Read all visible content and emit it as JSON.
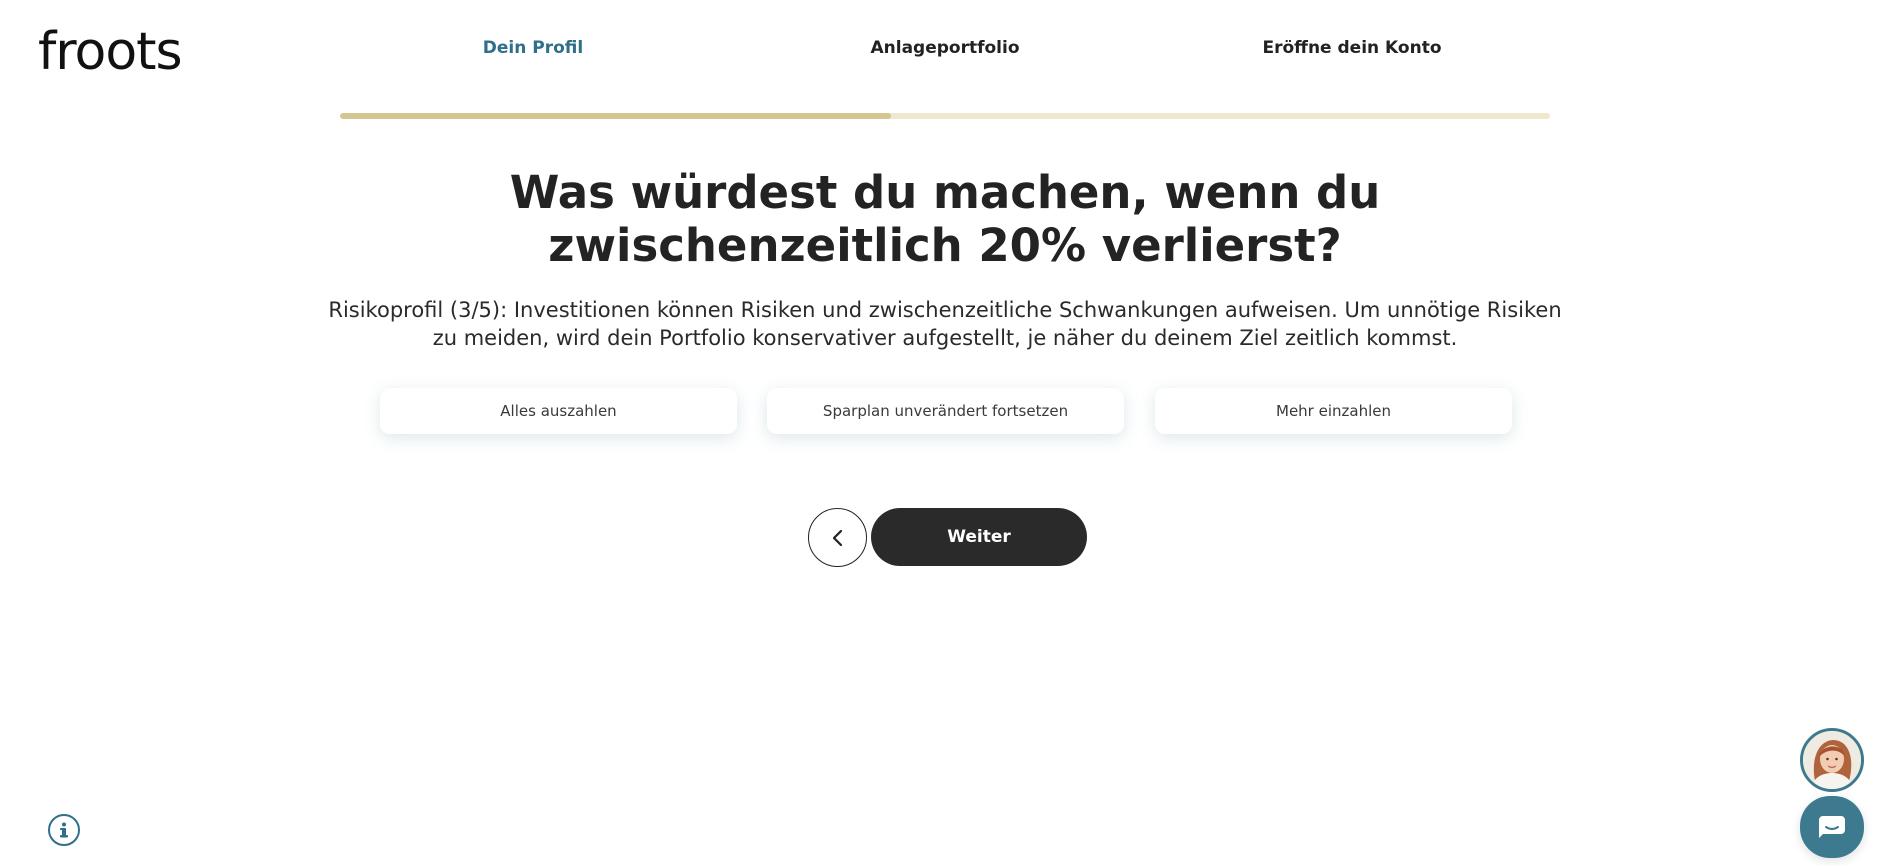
{
  "brand": {
    "logo_text": "froots"
  },
  "steps": [
    {
      "label": "Dein Profil",
      "active": true
    },
    {
      "label": "Anlageportfolio",
      "active": false
    },
    {
      "label": "Eröffne dein Konto",
      "active": false
    }
  ],
  "progress": {
    "fraction": 0.455
  },
  "question": {
    "title": "Was würdest du machen, wenn du zwischenzeitlich 20% verlierst?",
    "description": "Risikoprofil (3/5): Investitionen können Risiken und zwischenzeitliche Schwankungen aufweisen. Um unnötige Risiken zu meiden, wird dein Portfolio konservativer aufgestellt, je näher du deinem Ziel zeitlich kommst."
  },
  "options": [
    {
      "label": "Alles auszahlen"
    },
    {
      "label": "Sparplan unverändert fortsetzen"
    },
    {
      "label": "Mehr einzahlen"
    }
  ],
  "navigation": {
    "back_icon": "chevron-left-icon",
    "next_label": "Weiter"
  },
  "widgets": {
    "info_icon": "info-icon",
    "chat_icon": "chat-icon",
    "avatar": "advisor-avatar"
  },
  "colors": {
    "accent": "#2f6f8b",
    "progress_fill": "#d3c691",
    "progress_track": "#efe7ce",
    "button_dark": "#2a2a2a",
    "chat_button": "#3e7a8f"
  }
}
